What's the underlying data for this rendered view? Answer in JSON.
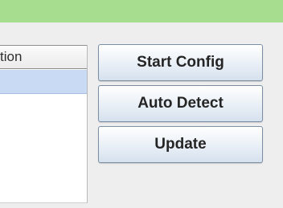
{
  "list": {
    "header": "tion"
  },
  "buttons": {
    "start_config": "Start Config",
    "auto_detect": "Auto Detect",
    "update": "Update"
  },
  "colors": {
    "title_bar": "#a6dd8e",
    "selected_row": "#c9daf5",
    "panel_background": "#eeeeee"
  }
}
